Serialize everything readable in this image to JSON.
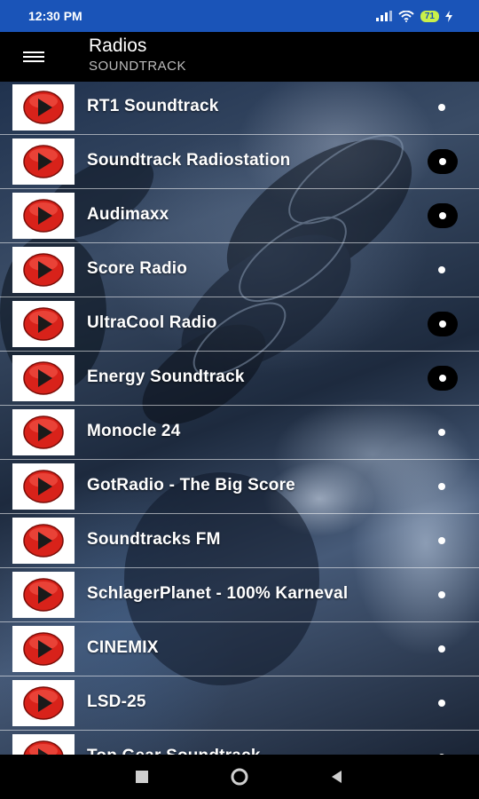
{
  "status_bar": {
    "time": "12:30 PM",
    "battery_level": "71",
    "icons": [
      "signal-icon",
      "wifi-icon",
      "battery-icon",
      "charging-icon"
    ]
  },
  "app_bar": {
    "title": "Radios",
    "subtitle": "SOUNDTRACK",
    "menu_icon": "hamburger-menu-icon"
  },
  "stations": [
    {
      "label": "RT1 Soundtrack",
      "indicator": "dot"
    },
    {
      "label": "Soundtrack Radiostation",
      "indicator": "boxed-dot"
    },
    {
      "label": "Audimaxx",
      "indicator": "boxed-dot"
    },
    {
      "label": "Score Radio",
      "indicator": "dot"
    },
    {
      "label": "UltraCool Radio",
      "indicator": "boxed-dot"
    },
    {
      "label": "Energy Soundtrack",
      "indicator": "boxed-dot"
    },
    {
      "label": "Monocle 24",
      "indicator": "dot"
    },
    {
      "label": "GotRadio - The Big Score",
      "indicator": "dot"
    },
    {
      "label": "Soundtracks FM",
      "indicator": "dot"
    },
    {
      "label": "SchlagerPlanet - 100% Karneval",
      "indicator": "dot"
    },
    {
      "label": "CINEMIX",
      "indicator": "dot"
    },
    {
      "label": "LSD-25",
      "indicator": "dot"
    },
    {
      "label": "Top Gear Soundtrack",
      "indicator": "dot"
    }
  ],
  "nav_bar": {
    "buttons": [
      "recents-square-icon",
      "home-circle-icon",
      "back-triangle-icon"
    ]
  },
  "colors": {
    "status_bar": "#1a54b8",
    "play_red": "#d8221a",
    "battery": "#c9f04a"
  }
}
